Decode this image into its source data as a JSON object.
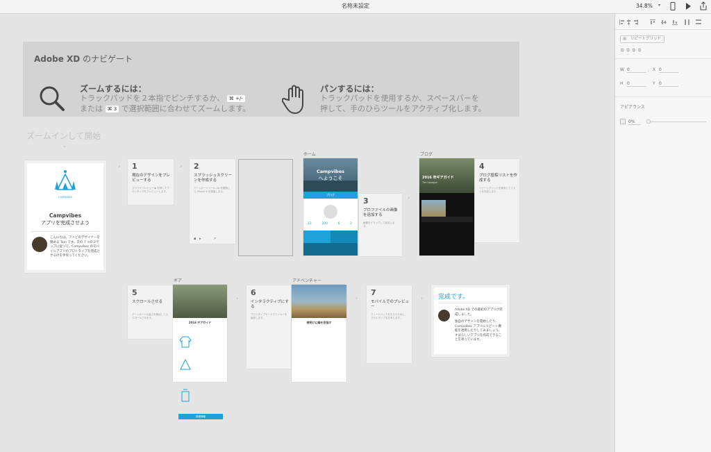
{
  "app": {
    "title": "名称未設定",
    "zoom": "34.8%"
  },
  "nav": {
    "title_bold": "Adobe XD",
    "title_rest": " のナビゲート",
    "zoom_head": "ズームするには：",
    "zoom_line1": "トラックパッドを２本指でピンチするか、",
    "zoom_key1": "⌘ +/-",
    "zoom_line2a": "または",
    "zoom_key2": "⌘ 3",
    "zoom_line2b": "で選択範囲に合わせてズームします。",
    "pan_head": "パンするには：",
    "pan_line1": "トラックパッドを使用するか、スペースバーを",
    "pan_line2": "押して、手のひらツールをアクティブ化します。"
  },
  "zoom_in_label": "ズームインして開始",
  "intro": {
    "brand": "CAMPVIBES",
    "title": "Campvibes",
    "subtitle": "アプリを完成させよう",
    "body": "こんにちは。アドビのデザイナーを務める Tain です。次の 7 つのステップに従って、Campvibes のモバイルアプリのプロトタイプを完成させるのを手伝ってください。"
  },
  "steps": [
    {
      "num": "1",
      "title": "現在のデザインをプレビューする",
      "text": "ブラウザプレビュー ▶ を押してプロトタイプをプレビューします。"
    },
    {
      "num": "2",
      "title": "スプラッシュスクリーンを作成する",
      "text": "アートボードツール (A) を選択して iPhone 6 を描画します。"
    },
    {
      "num": "3",
      "title": "プロファイルの画像を追加する",
      "text": "画像をドラッグして追加します。"
    },
    {
      "num": "4",
      "title": "ブログ投稿リストを作成する",
      "text": "リピートグリッドを使用してリストを作成します。"
    },
    {
      "num": "5",
      "title": "スクロールさせる",
      "text": "アートボードの高さを伸ばしてスクロールさせます。"
    },
    {
      "num": "6",
      "title": "インタラクティブにする",
      "text": "プロトタイプモードでワイヤーを接続します。"
    },
    {
      "num": "7",
      "title": "モバイルでのプレビュー",
      "text": "フィードバックをもらうために、プロトタイプを共有します。"
    }
  ],
  "artboard_labels": {
    "home": "ホーム",
    "blog": "ブログ",
    "gear": "ギア",
    "adventure": "アドベンチャー"
  },
  "home": {
    "app_name": "Campvibes",
    "welcome": "へようこそ",
    "blog_btn": "ブログ",
    "stat1": "12",
    "stat2": "200",
    "stat3": "6",
    "stat4": "2"
  },
  "blog": {
    "headline": "2016 年ギアガイド",
    "sub": "Tim Sprague"
  },
  "gear": {
    "heading": "2016 ギアガイド",
    "cta": "詳細情報"
  },
  "adventure": {
    "heading": "夜明けに峰を目指す"
  },
  "done": {
    "title": "完成です。",
    "line1": "Adobe XD での最初のアプリが完成しました。",
    "line2": "独自のデザインを開始したり、Campvibes アプリにリピート機能を適用したりしてみましょう。すばらしいアプリを作成できることを祈っています。"
  },
  "panel": {
    "repeat_grid": "リピートグリッド",
    "w_label": "W",
    "w_value": "0",
    "x_label": "X",
    "x_value": "0",
    "h_label": "H",
    "h_value": "0",
    "y_label": "Y",
    "y_value": "0",
    "appearance": "アピアランス",
    "opacity": "0%"
  },
  "colors": {
    "accent": "#1fa2d8",
    "panel_bg": "#f7f7f7",
    "canvas_bg": "#e5e5e5"
  }
}
